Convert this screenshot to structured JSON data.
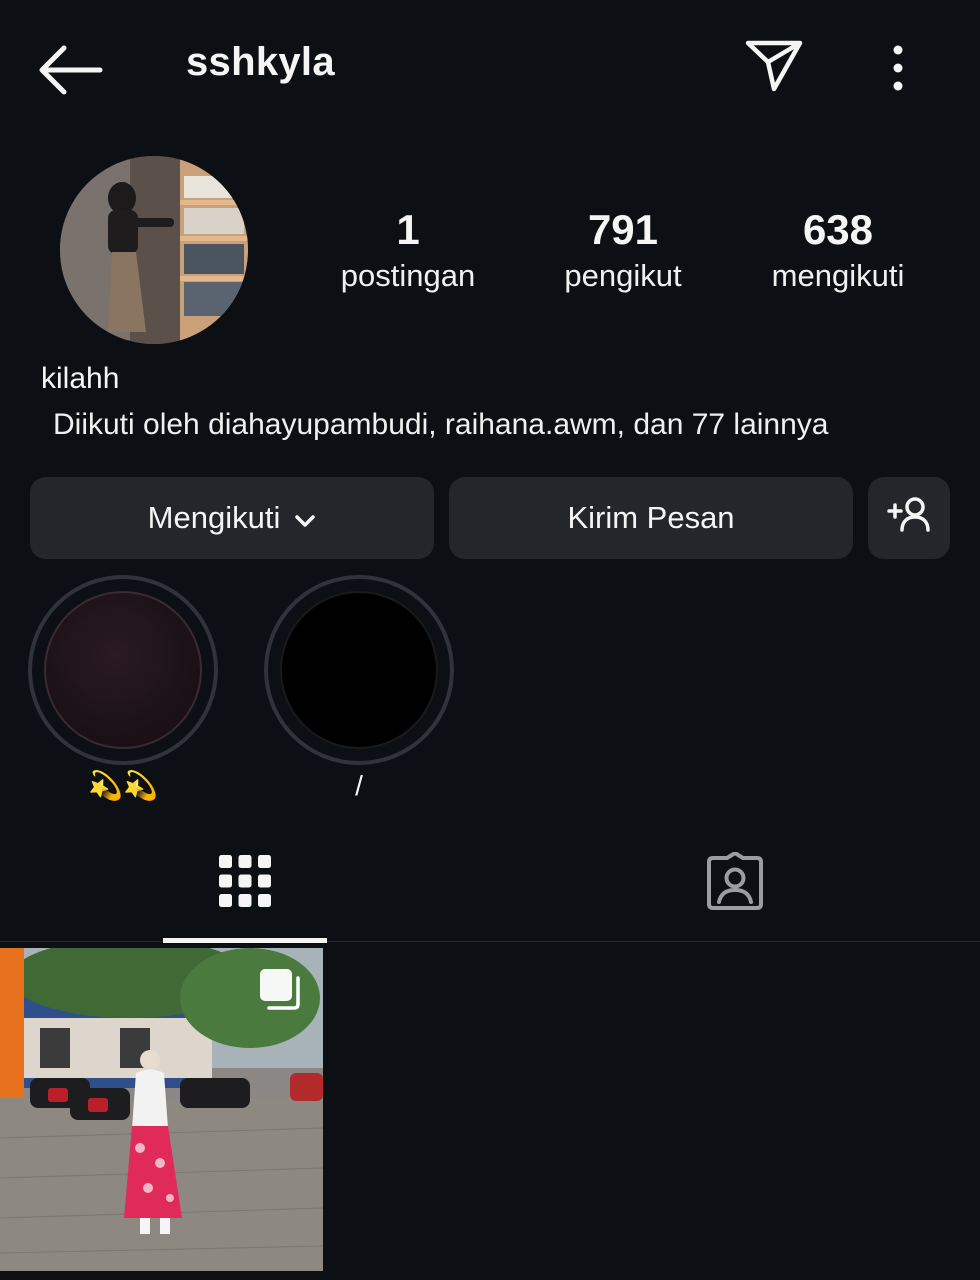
{
  "header": {
    "username": "sshkyla",
    "back_icon": "arrow-left-icon",
    "send_icon": "paper-plane-icon",
    "more_icon": "vertical-dots-icon"
  },
  "profile": {
    "avatar_icon": "profile-photo",
    "stats": [
      {
        "value": "1",
        "label": "postingan"
      },
      {
        "value": "791",
        "label": "pengikut"
      },
      {
        "value": "638",
        "label": "mengikuti"
      }
    ],
    "full_name": "kilahh",
    "followed_by": "Diikuti oleh diahayupambudi, raihana.awm, dan 77 lainnya"
  },
  "actions": {
    "following_label": "Mengikuti",
    "message_label": "Kirim Pesan",
    "add_user_icon": "add-person-icon"
  },
  "highlights": [
    {
      "label": "💫💫"
    },
    {
      "label": "/"
    }
  ],
  "tabs": [
    {
      "icon": "grid-icon",
      "active": true
    },
    {
      "icon": "tagged-person-icon",
      "active": false
    }
  ],
  "colors": {
    "background": "#0c1014",
    "button_bg": "#23262b",
    "text": "#f5f5f5"
  }
}
